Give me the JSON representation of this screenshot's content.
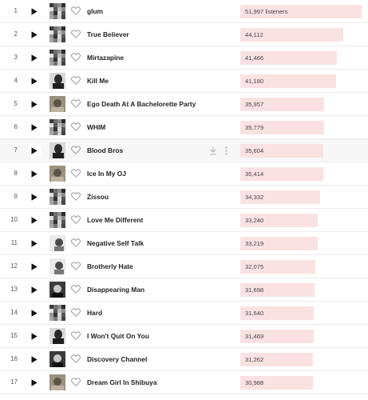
{
  "colors": {
    "bar": "#fbe2e2",
    "divider": "#ececec",
    "hover_row": "#f7f7f7",
    "title_text": "#222222",
    "rank_text": "#555555"
  },
  "hover_row_index": 6,
  "max_listeners": 51997,
  "tracks": [
    {
      "rank": "1",
      "title": "glum",
      "listeners": "51,997 listeners",
      "listeners_value": 51997,
      "thumb": "collage"
    },
    {
      "rank": "2",
      "title": "True Believer",
      "listeners": "44,112",
      "listeners_value": 44112,
      "thumb": "collage"
    },
    {
      "rank": "3",
      "title": "Mirtazapine",
      "listeners": "41,466",
      "listeners_value": 41466,
      "thumb": "collage"
    },
    {
      "rank": "4",
      "title": "Kill Me",
      "listeners": "41,180",
      "listeners_value": 41180,
      "thumb": "portrait"
    },
    {
      "rank": "5",
      "title": "Ego Death At A Bachelorette Party",
      "listeners": "35,957",
      "listeners_value": 35957,
      "thumb": "sepia"
    },
    {
      "rank": "6",
      "title": "WHIM",
      "listeners": "35,779",
      "listeners_value": 35779,
      "thumb": "collage"
    },
    {
      "rank": "7",
      "title": "Blood Bros",
      "listeners": "35,604",
      "listeners_value": 35604,
      "thumb": "portrait"
    },
    {
      "rank": "8",
      "title": "Ice In My OJ",
      "listeners": "35,414",
      "listeners_value": 35414,
      "thumb": "sepia"
    },
    {
      "rank": "9",
      "title": "Zissou",
      "listeners": "34,332",
      "listeners_value": 34332,
      "thumb": "collage"
    },
    {
      "rank": "10",
      "title": "Love Me Different",
      "listeners": "33,240",
      "listeners_value": 33240,
      "thumb": "collage"
    },
    {
      "rank": "11",
      "title": "Negative Self Talk",
      "listeners": "33,219",
      "listeners_value": 33219,
      "thumb": "light"
    },
    {
      "rank": "12",
      "title": "Brotherly Hate",
      "listeners": "32,075",
      "listeners_value": 32075,
      "thumb": "light"
    },
    {
      "rank": "13",
      "title": "Disappearing Man",
      "listeners": "31,698",
      "listeners_value": 31698,
      "thumb": "dark"
    },
    {
      "rank": "14",
      "title": "Hard",
      "listeners": "31,640",
      "listeners_value": 31640,
      "thumb": "collage"
    },
    {
      "rank": "15",
      "title": "I Won't Quit On You",
      "listeners": "31,469",
      "listeners_value": 31469,
      "thumb": "portrait"
    },
    {
      "rank": "16",
      "title": "Discovery Channel",
      "listeners": "31,262",
      "listeners_value": 31262,
      "thumb": "dark"
    },
    {
      "rank": "17",
      "title": "Dream Girl In Shibuya",
      "listeners": "30,988",
      "listeners_value": 30988,
      "thumb": "sepia"
    }
  ],
  "row_icons": {
    "play": "play-icon",
    "love": "heart-outline-icon",
    "download": "download-icon",
    "more": "more-vertical-icon"
  }
}
